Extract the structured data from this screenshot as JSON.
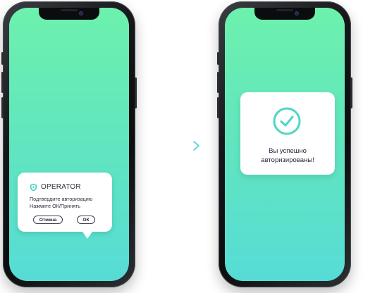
{
  "colors": {
    "screen_gradient_top": "#6df1ad",
    "screen_gradient_bottom": "#56dcd6",
    "accent_teal": "#4fd6c4",
    "arrow_teal": "#46cfe0",
    "frame_dark": "#0c0d0f"
  },
  "left_phone": {
    "notification": {
      "app_name": "OPERATOR",
      "app_icon": "shield-icon",
      "message_line1": "Подтвердите авторизацию",
      "message_line2": "Нажмите ОК/Принять",
      "cancel_label": "Отмена",
      "ok_label": "ОК"
    }
  },
  "transition": {
    "icon": "arrow-right-icon"
  },
  "right_phone": {
    "success": {
      "icon": "check-circle-icon",
      "message": "Вы успешно\nавторизированы!"
    }
  }
}
